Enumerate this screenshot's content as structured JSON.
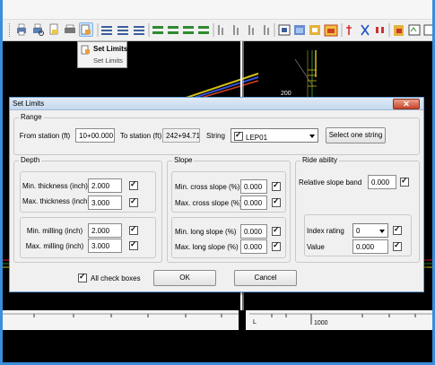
{
  "tooltip": {
    "title": "Set Limits",
    "subtitle": "Set Limits"
  },
  "canvas": {
    "label_top": "200",
    "label_bottom": "1000",
    "label_l": "L"
  },
  "dialog": {
    "title": "Set Limits",
    "close_symbol": "✕",
    "range": {
      "legend": "Range",
      "from_station_label": "From station (ft)",
      "from_station_value": "10+00.000",
      "to_station_label": "To station (ft)",
      "to_station_value": "242+94.71",
      "string_label": "String",
      "string_value": "LEP01",
      "string_checked": true,
      "select_button": "Select one string"
    },
    "depth": {
      "legend": "Depth",
      "min_thickness_label": "Min. thickness (inch)",
      "min_thickness_value": "2.000",
      "max_thickness_label": "Max. thickness (inch)",
      "max_thickness_value": "3.000",
      "min_milling_label": "Min. milling (inch)",
      "min_milling_value": "2.000",
      "max_milling_label": "Max. milling (inch)",
      "max_milling_value": "3.000"
    },
    "slope": {
      "legend": "Slope",
      "min_cross_label": "Min. cross slope (%)",
      "min_cross_value": "0.000",
      "max_cross_label": "Max. cross slope (%)",
      "max_cross_value": "0.000",
      "min_long_label": "Min. long slope (%)",
      "min_long_value": "0.000",
      "max_long_label": "Max. long slope (%)",
      "max_long_value": "0.000"
    },
    "ride": {
      "legend": "Ride ability",
      "relative_band_label": "Relative slope band",
      "relative_band_value": "0.000",
      "index_rating_label": "Index rating",
      "index_rating_value": "0",
      "value_label": "Value",
      "value_value": "0.000"
    },
    "all_check_boxes_label": "All check boxes",
    "ok_button": "OK",
    "cancel_button": "Cancel"
  }
}
